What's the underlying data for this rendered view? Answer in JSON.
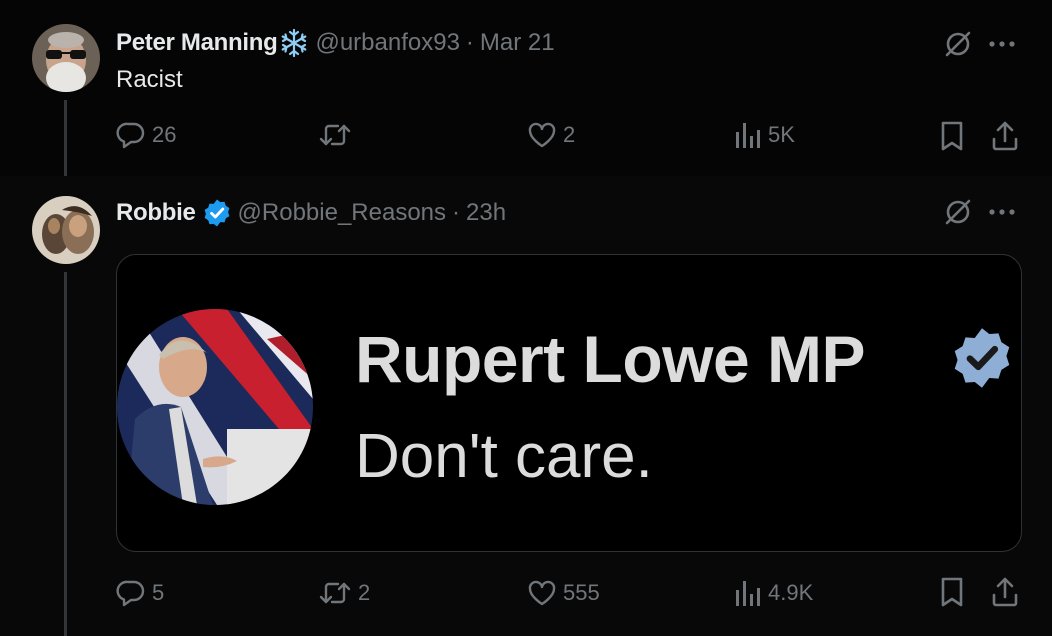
{
  "tweets": [
    {
      "author": {
        "name": "Peter Manning",
        "handle": "@urbanfox93",
        "emoji_icon": "snowflake-icon"
      },
      "separator": "·",
      "timestamp": "Mar 21",
      "text": "Racist",
      "actions": {
        "replies": "26",
        "retweets": "",
        "likes": "2",
        "views": "5K"
      }
    },
    {
      "author": {
        "name": "Robbie",
        "handle": "@Robbie_Reasons",
        "verified": true
      },
      "separator": "·",
      "timestamp": "23h",
      "embed": {
        "title": "Rupert Lowe MP",
        "text": "Don't care."
      },
      "actions": {
        "replies": "5",
        "retweets": "2",
        "likes": "555",
        "views": "4.9K"
      }
    }
  ],
  "colors": {
    "background": "#000000",
    "text_primary": "#e7e9ea",
    "text_secondary": "#71767b",
    "verified_blue": "#1d9bf0",
    "thread_line": "#333639",
    "snowflake": "#8ecdf5"
  }
}
